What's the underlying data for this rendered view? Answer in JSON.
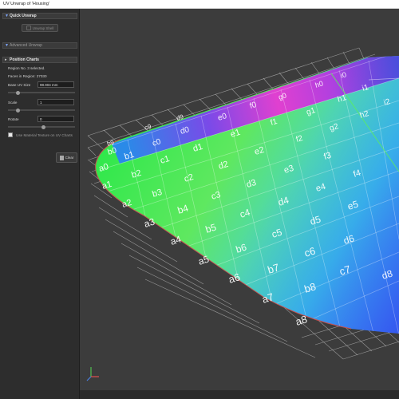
{
  "window": {
    "title": "UV Unwrap of 'Housing'"
  },
  "panel": {
    "quick_unwrap": {
      "header": "Quick Unwrap",
      "unwrap_shell_label": "Unwrap Shell"
    },
    "advanced_unwrap": {
      "header": "Advanced Unwrap"
    },
    "position_charts": {
      "header": "Position Charts",
      "region_text": "Region No. 3 selected.",
      "faces_text": "Faces in Region: 27030",
      "base_uv_size_label": "Base UV Size",
      "base_uv_size_value": "98.904 mm",
      "scale_label": "Scale",
      "scale_value": "1",
      "rotate_label": "Rotate",
      "rotate_value": "0",
      "use_material_label": "Use Material Texture on UV Charts",
      "use_material_checked": false,
      "clear_label": "Clear"
    }
  },
  "viewport": {
    "grid_labels": [
      "a0",
      "a1",
      "a2",
      "a3",
      "a4",
      "a5",
      "a6",
      "a7",
      "a8",
      "b0",
      "b1",
      "b2",
      "b3",
      "b4",
      "b5",
      "b6",
      "b7",
      "b8",
      "b9",
      "c0",
      "c1",
      "c2",
      "c3",
      "c4",
      "c5",
      "c6",
      "c7",
      "c9",
      "d0",
      "d1",
      "d2",
      "d3",
      "d4",
      "d5",
      "d6",
      "d8",
      "d9",
      "e0",
      "e1",
      "e2",
      "e3",
      "e4",
      "e5",
      "f0",
      "f1",
      "f2",
      "f3",
      "f4",
      "g0",
      "g1",
      "g2",
      "h0",
      "h1",
      "h2",
      "i0",
      "i1",
      "i2"
    ],
    "axis_indicator": {
      "x_color": "#e05050",
      "y_color": "#50c050",
      "z_color": "#4a7fe0"
    }
  }
}
